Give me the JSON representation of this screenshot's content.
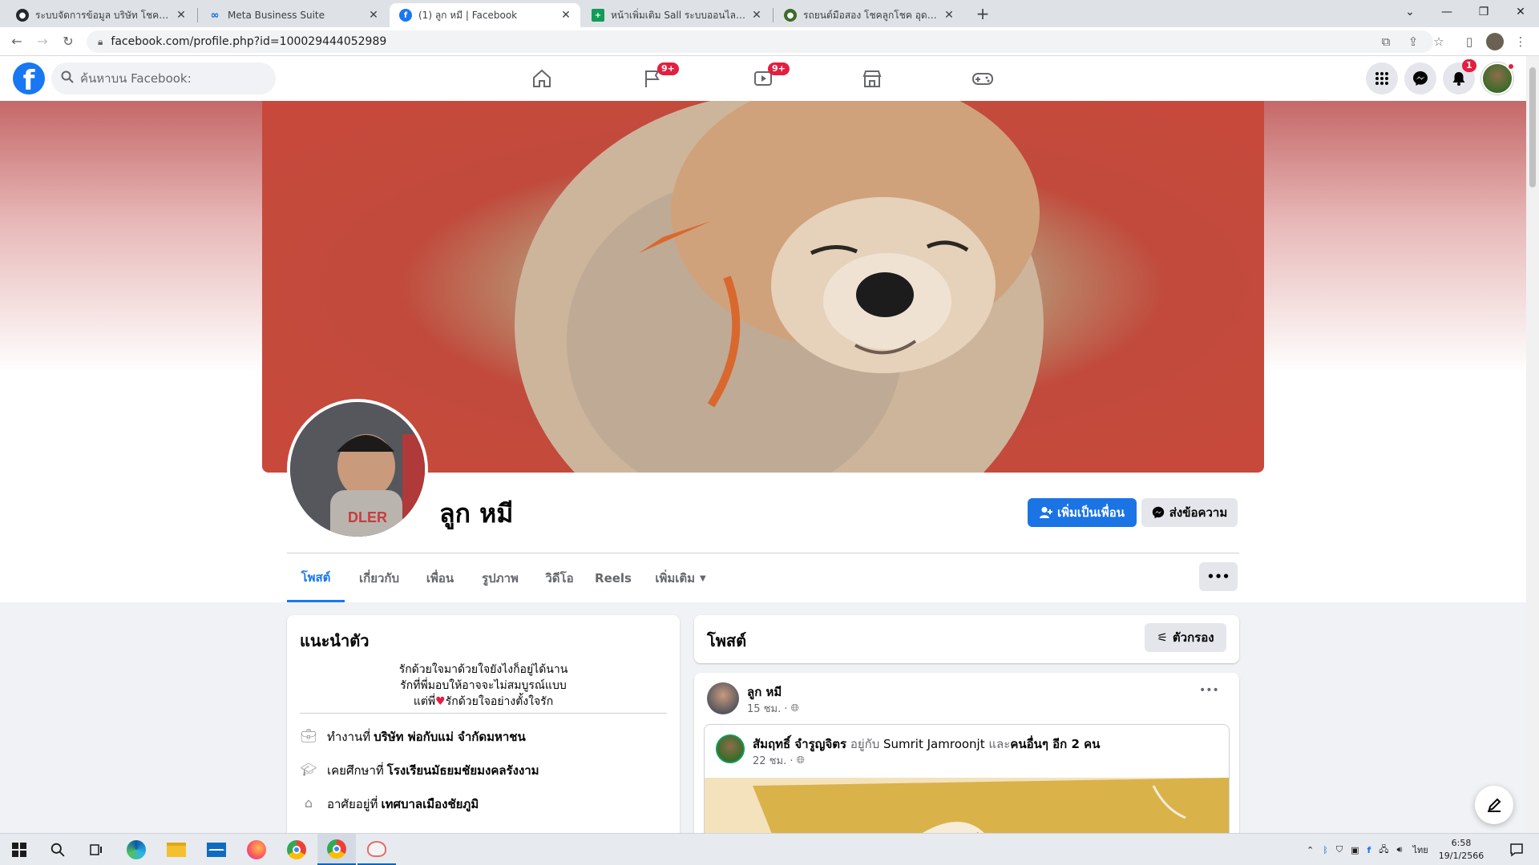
{
  "browser": {
    "tabs": [
      {
        "title": "ระบบจัดการข้อมูล บริษัท โชคลูกโชค จำกัด",
        "favicon": "github-icon",
        "active": false
      },
      {
        "title": "Meta Business Suite",
        "favicon": "meta-icon",
        "active": false
      },
      {
        "title": "(1) ลูก หมี | Facebook",
        "favicon": "facebook-icon",
        "active": true
      },
      {
        "title": "หน้าเพิ่มเติม Sall ระบบออนไลน์.xlsx - G",
        "favicon": "sheets-icon",
        "active": false
      },
      {
        "title": "รถยนต์มือสอง โชคลูกโชค อุดรธานี",
        "favicon": "site-icon",
        "active": false
      }
    ],
    "url": "facebook.com/profile.php?id=100029444052989"
  },
  "fb_header": {
    "search_placeholder": "ค้นหาบน Facebook:",
    "nav_badges": {
      "pages": "9+",
      "watch": "9+"
    },
    "notification_count": "1"
  },
  "profile": {
    "name": "ลูก หมี",
    "add_friend_label": "เพิ่มเป็นเพื่อน",
    "message_label": "ส่งข้อความ",
    "tabs": [
      "โพสต์",
      "เกี่ยวกับ",
      "เพื่อน",
      "รูปภาพ",
      "วิดีโอ",
      "Reels",
      "เพิ่มเติม"
    ],
    "active_tab": "โพสต์"
  },
  "intro": {
    "title": "แนะนำตัว",
    "bio_line1": "รักด้วยใจมาด้วยใจยังไงก็อยู่ได้นาน",
    "bio_line2": "รักที่พี่มอบให้อาจจะไม่สมบูรณ์แบบ",
    "bio_line3_a": "แต่พี่",
    "bio_line3_b": "รักด้วยใจอย่างตั้งใจรัก",
    "work_prefix": "ทำงานที่",
    "work_value": "บริษัท พ่อกับแม่ จำกัดมหาชน",
    "edu_prefix": "เคยศึกษาที่",
    "edu_value": "โรงเรียนมัธยมชัยมงคลรังงาม",
    "live_prefix": "อาศัยอยู่ที่",
    "live_value": "เทศบาลเมืองชัยภูมิ"
  },
  "posts_panel": {
    "title": "โพสต์",
    "filter_label": "ตัวกรอง"
  },
  "post": {
    "author": "ลูก หมี",
    "time": "15 ชม. ·",
    "shared_author": "สัมฤทธิ์ จำรูญจิตร",
    "shared_with_word": "อยู่กับ",
    "shared_with_name": "Sumrit Jamroonjt",
    "shared_and": "และ",
    "shared_others": "คนอื่นๆ อีก 2 คน",
    "shared_time": "22 ชม. ·"
  },
  "taskbar": {
    "lang": "ไทย",
    "time": "6:58",
    "date": "19/1/2566"
  },
  "colors": {
    "fb_blue": "#1877f2",
    "badge_red": "#e41e3f",
    "button_blue": "#1b74e4"
  }
}
